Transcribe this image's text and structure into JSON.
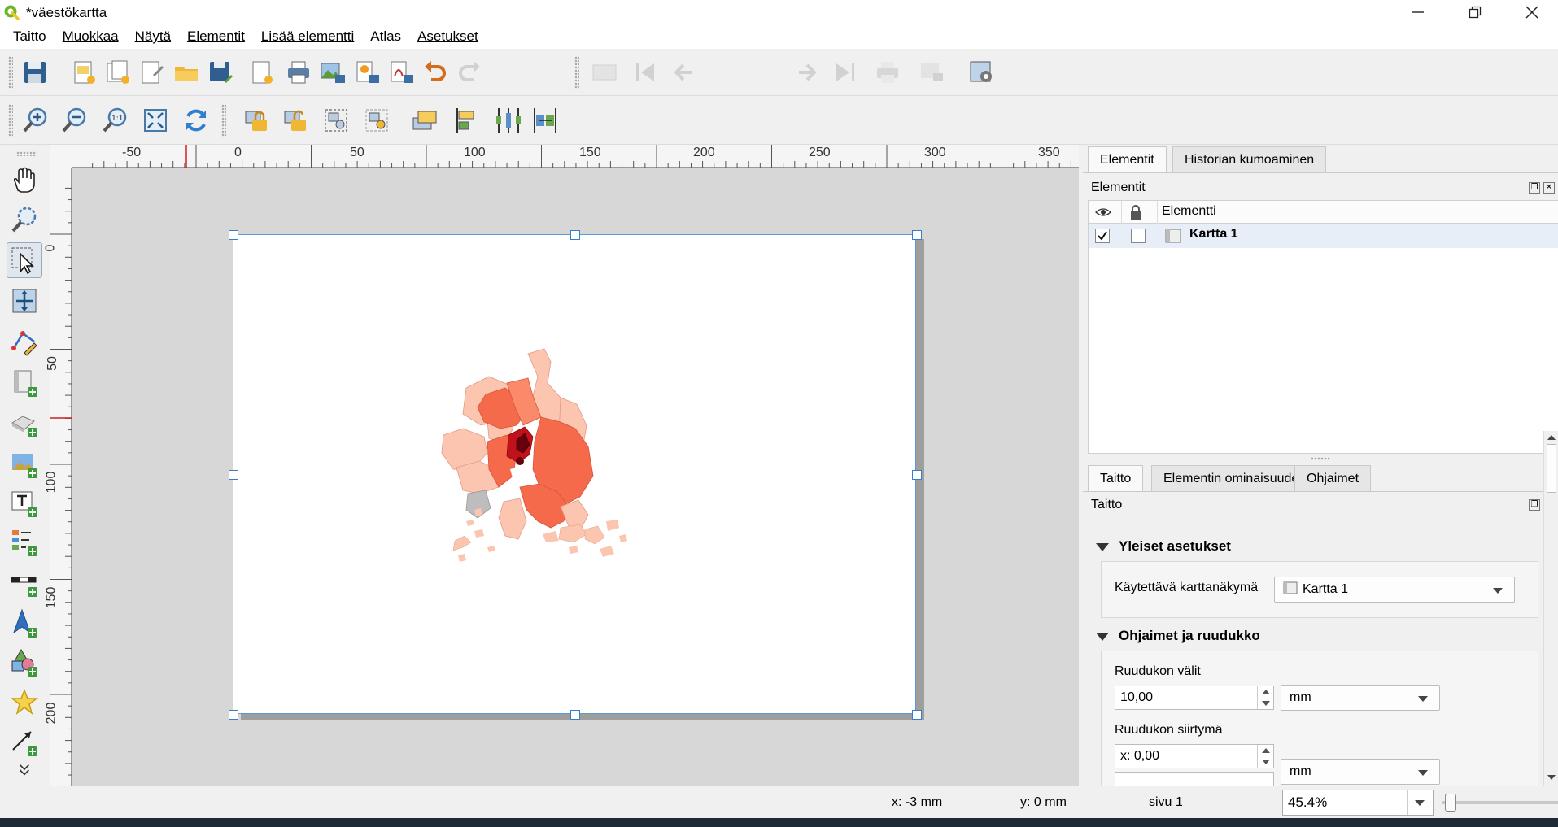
{
  "window": {
    "title": "*väestökartta"
  },
  "menu": [
    "Taitto",
    "Muokkaa",
    "Näytä",
    "Elementit",
    "Lisää elementti",
    "Atlas",
    "Asetukset"
  ],
  "toolbar": {
    "page_value": "1"
  },
  "ruler": {
    "h_labels": [
      "-50",
      "0",
      "50",
      "100",
      "150",
      "200",
      "250",
      "300",
      "350"
    ],
    "v_labels": [
      "0",
      "50",
      "100",
      "150",
      "200"
    ]
  },
  "right_dock": {
    "tabs_top": [
      "Elementit",
      "Historian kumoaminen"
    ],
    "items_panel_title": "Elementit",
    "items_col_header": "Elementti",
    "items": [
      {
        "name": "Kartta 1",
        "visible": true,
        "locked": false
      }
    ],
    "tabs_bottom": [
      "Taitto",
      "Elementin ominaisuudet",
      "Ohjaimet"
    ],
    "layout_panel_title": "Taitto",
    "general_group": "Yleiset asetukset",
    "map_view_label": "Käytettävä karttanäkymä",
    "map_view_value": "Kartta 1",
    "guides_group": "Ohjaimet ja ruudukko",
    "grid_spacing_label": "Ruudukon välit",
    "grid_spacing_value": "10,00",
    "grid_spacing_unit": "mm",
    "grid_offset_label": "Ruudukon siirtymä",
    "grid_offset_x": "x: 0,00",
    "grid_offset_unit": "mm"
  },
  "status": {
    "x": "x: -3 mm",
    "y": "y: 0 mm",
    "page": "sivu 1",
    "zoom": "45.4%"
  },
  "colors": {
    "choropleth": [
      "#fcc5b0",
      "#fb8a6a",
      "#f46a4b",
      "#c1121c",
      "#67000d",
      "#bdbdbd"
    ]
  }
}
